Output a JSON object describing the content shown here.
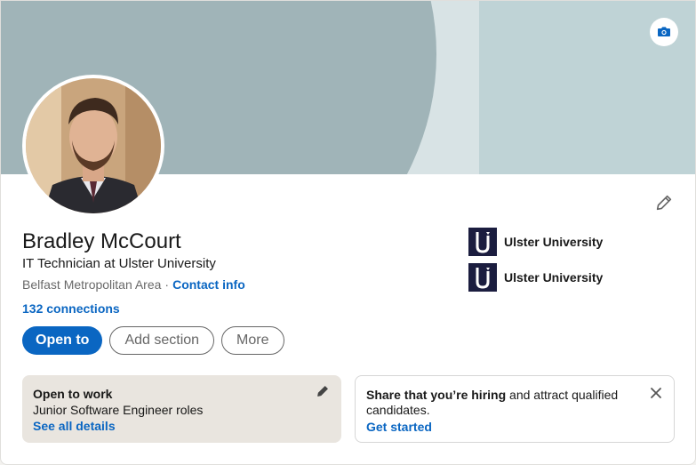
{
  "profile": {
    "name": "Bradley McCourt",
    "headline": "IT Technician at Ulster University",
    "location": "Belfast Metropolitan Area",
    "separator": "·",
    "contact_info": "Contact info",
    "connections": "132 connections"
  },
  "actions": {
    "open_to": "Open to",
    "add_section": "Add section",
    "more": "More"
  },
  "education": [
    {
      "name": "Ulster University",
      "logo": "ulster-university-logo"
    },
    {
      "name": "Ulster University",
      "logo": "ulster-university-logo"
    }
  ],
  "open_to_work": {
    "title": "Open to work",
    "roles": "Junior Software Engineer roles",
    "link": "See all details"
  },
  "hiring": {
    "bold_text": "Share that you’re hiring",
    "rest_text": " and attract qualified candidates.",
    "cta": "Get started"
  },
  "colors": {
    "accent": "#0a66c2",
    "banner_dark": "#a0b4b8",
    "banner_light": "#d8e3e5",
    "open_to_work_bg": "#e9e5df"
  },
  "icons": [
    "camera-icon",
    "pencil-icon",
    "close-icon"
  ]
}
